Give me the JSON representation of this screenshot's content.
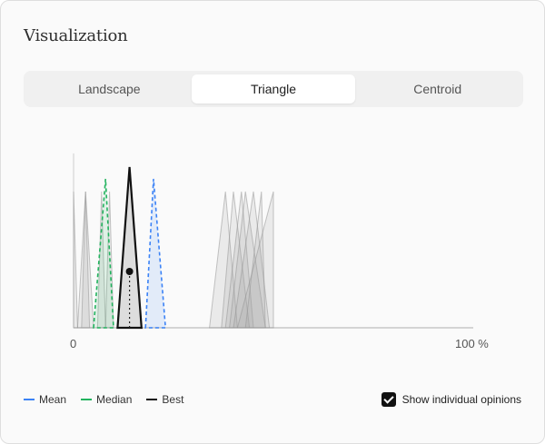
{
  "panel": {
    "title": "Visualization"
  },
  "tabs": [
    {
      "label": "Landscape",
      "active": false
    },
    {
      "label": "Triangle",
      "active": true
    },
    {
      "label": "Centroid",
      "active": false
    }
  ],
  "chart_data": {
    "type": "triangle",
    "xlim": [
      0,
      100
    ],
    "x_tick_labels": [
      "0",
      "100 %"
    ],
    "opinions": [
      {
        "low": 0,
        "mode": 0,
        "high": 1
      },
      {
        "low": 1,
        "mode": 3,
        "high": 4
      },
      {
        "low": 2,
        "mode": 3,
        "high": 5
      },
      {
        "low": 6,
        "mode": 7,
        "high": 8
      },
      {
        "low": 8,
        "mode": 9,
        "high": 10
      },
      {
        "low": 34,
        "mode": 38,
        "high": 41
      },
      {
        "low": 37,
        "mode": 40,
        "high": 44
      },
      {
        "low": 38,
        "mode": 42,
        "high": 45
      },
      {
        "low": 39,
        "mode": 43,
        "high": 48
      },
      {
        "low": 40,
        "mode": 45,
        "high": 49
      },
      {
        "low": 43,
        "mode": 47,
        "high": 48
      },
      {
        "low": 41,
        "mode": 50,
        "high": 50
      }
    ],
    "mean": {
      "low": 18,
      "mode": 20,
      "high": 23
    },
    "median": {
      "low": 5,
      "mode": 8,
      "high": 10
    },
    "best": {
      "low": 11,
      "mode": 14,
      "high": 17,
      "point": 14
    }
  },
  "legend": [
    {
      "label": "Mean",
      "color": "#3b82f6",
      "style": "dashed"
    },
    {
      "label": "Median",
      "color": "#22b35e",
      "style": "dashed"
    },
    {
      "label": "Best",
      "color": "#111111",
      "style": "solid"
    }
  ],
  "show_opinions": {
    "label": "Show individual opinions",
    "checked": true
  }
}
